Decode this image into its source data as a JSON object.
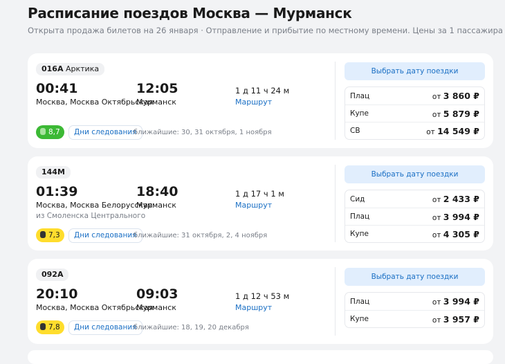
{
  "title": "Расписание поездов Москва — Мурманск",
  "subtitle": "Открыта продажа билетов на 26 января · Отправление и прибытие по местному времени. Цены за 1 пассажира",
  "pick_label": "Выбрать дату поездки",
  "days_label": "Дни следования",
  "route_label": "Маршрут",
  "from_prefix": "от",
  "colors": {
    "green": "#3cb935",
    "yellow": "#ffdd2d",
    "link": "#1a6fc4"
  },
  "trains": [
    {
      "number": "016А",
      "name": "Арктика",
      "dep": "00:41",
      "arr": "12:05",
      "dep_station": "Москва, Москва Октябрьская",
      "arr_station": "Мурманск",
      "duration": "1 д 11 ч 24 м",
      "rating": "8,7",
      "nearest": "ближайшие: 30, 31 октября, 1 ноября",
      "prices": [
        {
          "cls": "Плац",
          "price": "3 860 ₽"
        },
        {
          "cls": "Купе",
          "price": "5 879 ₽"
        },
        {
          "cls": "СВ",
          "price": "14 549 ₽"
        }
      ]
    },
    {
      "number": "144М",
      "dep": "01:39",
      "arr": "18:40",
      "dep_station": "Москва, Москва Белорусская",
      "arr_station": "Мурманск",
      "from_note": "из Смоленска Центрального",
      "duration": "1 д 17 ч 1 м",
      "rating": "7,3",
      "nearest": "ближайшие: 31 октября, 2, 4 ноября",
      "prices": [
        {
          "cls": "Сид",
          "price": "2 433 ₽"
        },
        {
          "cls": "Плац",
          "price": "3 994 ₽"
        },
        {
          "cls": "Купе",
          "price": "4 305 ₽"
        }
      ]
    },
    {
      "number": "092А",
      "dep": "20:10",
      "arr": "09:03",
      "dep_station": "Москва, Москва Октябрьская",
      "arr_station": "Мурманск",
      "duration": "1 д 12 ч 53 м",
      "rating": "7,8",
      "nearest": "ближайшие: 18, 19, 20 декабря",
      "prices": [
        {
          "cls": "Плац",
          "price": "3 994 ₽"
        },
        {
          "cls": "Купе",
          "price": "3 957 ₽"
        }
      ]
    }
  ]
}
